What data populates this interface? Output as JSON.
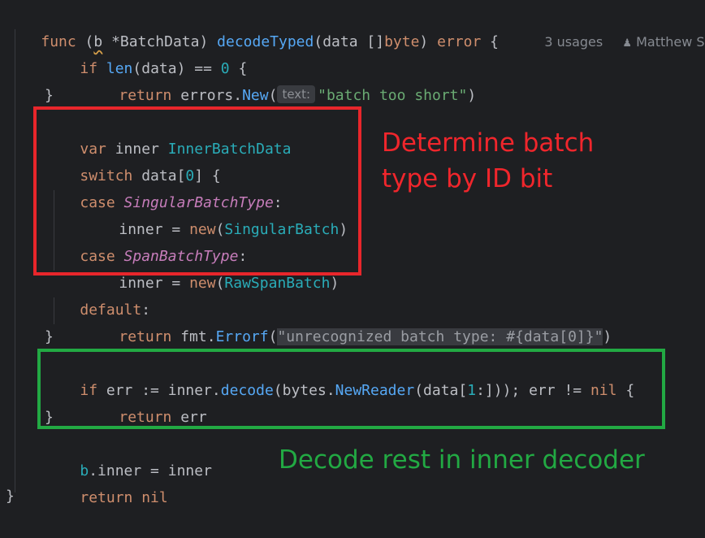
{
  "code": {
    "l1": {
      "kw_func": "func",
      "open": " (",
      "recv": "b",
      "recv_type": " *BatchData) ",
      "name": "decodeTyped",
      "params": "(data []",
      "byte": "byte",
      "close": ") ",
      "err": "error",
      "brace": " {"
    },
    "meta": {
      "usages": "3 usages",
      "author": "Matthew Slip"
    },
    "l2": {
      "kw": "if ",
      "len": "len",
      "rest": "(data) == ",
      "zero": "0",
      "brace": " {"
    },
    "l3": {
      "kw": "return ",
      "pkg": "errors.",
      "fn": "New",
      "paren": "(",
      "hint": "text:",
      "str": "\"batch too short\"",
      "close": ")"
    },
    "l4": {
      "text": "}"
    },
    "l5": {
      "kw": "var ",
      "name": "inner ",
      "type": "InnerBatchData"
    },
    "l6": {
      "kw": "switch ",
      "rest": "data[",
      "zero": "0",
      "close": "] {"
    },
    "l7": {
      "kw": "case ",
      "type": "SingularBatchType",
      "colon": ":"
    },
    "l8": {
      "lhs": "inner = ",
      "kw": "new",
      "paren": "(",
      "type": "SingularBatch",
      "close": ")"
    },
    "l9": {
      "kw": "case ",
      "type": "SpanBatchType",
      "colon": ":"
    },
    "l10": {
      "lhs": "inner = ",
      "kw": "new",
      "paren": "(",
      "type": "RawSpanBatch",
      "close": ")"
    },
    "l11": {
      "kw": "default",
      "colon": ":"
    },
    "l12": {
      "kw": "return ",
      "pkg": "fmt.",
      "fn": "Errorf",
      "paren": "(",
      "str": "\"unrecognized batch type: #{data[0]}\"",
      "close": ")"
    },
    "l13": {
      "text": "}"
    },
    "l14": {
      "kw": "if ",
      "a": "err := inner.",
      "fn": "decode",
      "b": "(bytes.",
      "fn2": "NewReader",
      "c": "(data[",
      "one": "1",
      "d": ":])); err != ",
      "nil": "nil",
      "e": " {"
    },
    "l15": {
      "kw": "return ",
      "rest": "err"
    },
    "l16": {
      "text": "}"
    },
    "l17": {
      "recv": "b",
      "rest": ".inner = inner"
    },
    "l18": {
      "kw": "return ",
      "nil": "nil"
    },
    "l19": {
      "text": "}"
    }
  },
  "annotations": {
    "red_line1": "Determine batch",
    "red_line2": "type by ID bit",
    "green": "Decode rest in inner decoder"
  },
  "colors": {
    "red": "#e8262b",
    "green": "#22a943",
    "background": "#1e1f22"
  }
}
